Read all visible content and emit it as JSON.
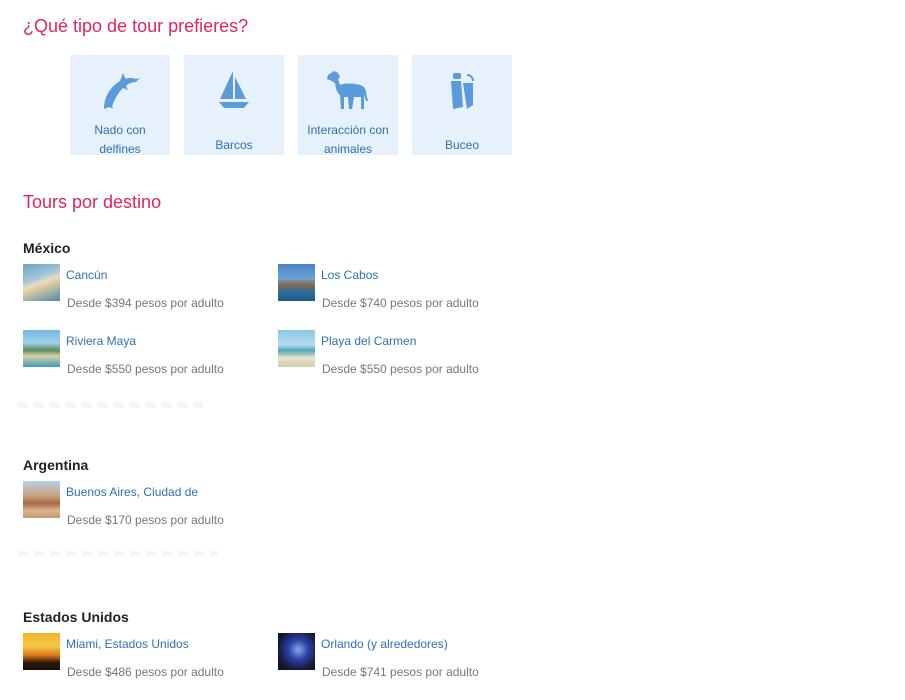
{
  "tour_types": {
    "heading": "¿Qué tipo de tour prefieres?",
    "items": [
      {
        "label": "Nado con delfines",
        "icon": "dolphin-icon"
      },
      {
        "label": "Barcos",
        "icon": "sailboat-icon"
      },
      {
        "label": "Interacción con animales",
        "icon": "horse-icon"
      },
      {
        "label": "Buceo",
        "icon": "scuba-gear-icon"
      }
    ]
  },
  "destinations": {
    "heading": "Tours por destino",
    "countries": [
      {
        "name": "México",
        "items": [
          {
            "name": "Cancún",
            "price": "Desde $394 pesos por adulto"
          },
          {
            "name": "Los Cabos",
            "price": "Desde $740 pesos por adulto"
          },
          {
            "name": "Riviera Maya",
            "price": "Desde $550 pesos por adulto"
          },
          {
            "name": "Playa del Carmen",
            "price": "Desde $550 pesos por adulto"
          }
        ]
      },
      {
        "name": "Argentina",
        "items": [
          {
            "name": "Buenos Aires, Ciudad de",
            "price": "Desde $170 pesos por adulto"
          }
        ]
      },
      {
        "name": "Estados Unidos",
        "items": [
          {
            "name": "Miami, Estados Unidos",
            "price": "Desde $486 pesos por adulto"
          },
          {
            "name": "Orlando (y alrededores)",
            "price": "Desde $741 pesos por adulto"
          }
        ]
      }
    ]
  },
  "colors": {
    "heading": "#e0245e",
    "link": "#2a72b8",
    "card_bg": "#e7f1fb",
    "icon": "#5b9bdc"
  }
}
